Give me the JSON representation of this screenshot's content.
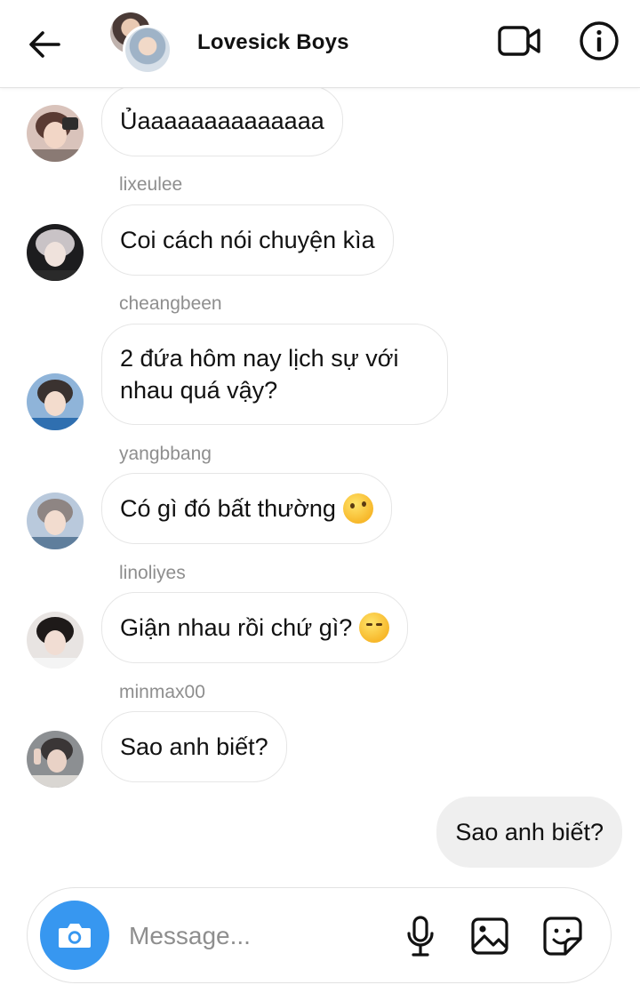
{
  "header": {
    "title": "Lovesick Boys",
    "back_icon": "arrow-left-icon",
    "video_icon": "video-camera-icon",
    "info_icon": "info-icon"
  },
  "messages": [
    {
      "sender": "",
      "text": "Ủaaaaaaaaaaaaaa",
      "emoji": ""
    },
    {
      "sender": "lixeulee",
      "text": "Coi cách nói chuyện kìa",
      "emoji": ""
    },
    {
      "sender": "cheangbeen",
      "text": "2 đứa hôm nay lịch sự với nhau quá vậy?",
      "emoji": ""
    },
    {
      "sender": "yangbbang",
      "text": "Có gì đó bất thường",
      "emoji": "thinking-face"
    },
    {
      "sender": "linoliyes",
      "text": "Giận nhau rồi chứ gì?",
      "emoji": "relieved-face"
    },
    {
      "sender": "minmax00",
      "text": "Sao anh biết?",
      "emoji": ""
    }
  ],
  "own_message": {
    "text": "Sao anh biết?"
  },
  "composer": {
    "placeholder": "Message...",
    "camera_icon": "camera-icon",
    "mic_icon": "microphone-icon",
    "gallery_icon": "image-icon",
    "sticker_icon": "sticker-icon"
  },
  "colors": {
    "accent": "#3797f0",
    "own_bubble": "#efefef",
    "sender_text": "#8e8e8e"
  }
}
